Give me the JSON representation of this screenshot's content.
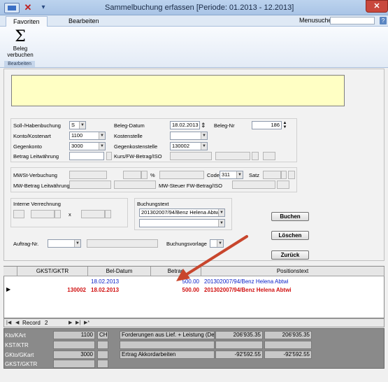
{
  "window": {
    "title": "Sammelbuchung erfassen  [Periode: 01.2013 - 12.2013]",
    "close_glyph": "✕"
  },
  "tabs": [
    {
      "label": "Favoriten"
    },
    {
      "label": "Bearbeiten"
    }
  ],
  "menusuche": {
    "label": "Menusuche",
    "value": "",
    "help": "?"
  },
  "ribbon": {
    "button_icon": "Σ",
    "button_line1": "Beleg",
    "button_line2": "verbuchen",
    "group_label": "Bearbeiten"
  },
  "form": {
    "soll_haben": {
      "label": "Soll-/Habenbuchung",
      "value": "S"
    },
    "konto": {
      "label": "Konto/Kostenart",
      "value": "1100"
    },
    "gegenkonto": {
      "label": "Gegenkonto",
      "value": "3000"
    },
    "betrag_lw": {
      "label": "Betrag Leitwährung",
      "value": ""
    },
    "beleg_datum": {
      "label": "Beleg-Datum",
      "value": "18.02.2013"
    },
    "kostenstelle": {
      "label": "Kostenstelle",
      "value": ""
    },
    "gegenkostenstelle": {
      "label": "Gegenkostenstelle",
      "value": "130002"
    },
    "kurs": {
      "label": "Kurs/FW-Betrag/ISO"
    },
    "beleg_nr": {
      "label": "Beleg-Nr",
      "value": "186"
    },
    "mwst": {
      "label": "MWSt-Verbuchung",
      "percent": "%",
      "code_label": "Code",
      "code_value": "311",
      "satz_label": "Satz"
    },
    "mw_betrag": {
      "label": "MW-Betrag Leitwährung",
      "steuer_label": "MW-Steuer FW-Betrag/ISO"
    },
    "interne": {
      "label": "Interne Verrechnung",
      "x": "x"
    },
    "buchungstext": {
      "label": "Buchungstext",
      "value": "201302007/94/Benz Helena Abtwi"
    },
    "auftrag": {
      "label": "Auftrag-Nr."
    },
    "buchungsvorlage": {
      "label": "Buchungsvorlage"
    }
  },
  "buttons": {
    "buchen": "Buchen",
    "loeschen": "Löschen",
    "zurueck": "Zurück"
  },
  "grid": {
    "headers": [
      "GKST/GKTR",
      "Bel-Datum",
      "Betrag",
      "Positionstext"
    ],
    "rows": [
      {
        "gkst": "",
        "datum": "18.02.2013",
        "betrag": "500.00",
        "text": "201302007/94/Benz Helena Abtwi",
        "style": "blue"
      },
      {
        "gkst": "130002",
        "datum": "18.02.2013",
        "betrag": "500.00",
        "text": "201302007/94/Benz Helena Abtwi",
        "style": "red"
      }
    ],
    "row_indicator": "▶"
  },
  "navigator": {
    "record_label": "Record",
    "record_value": "2"
  },
  "summary": {
    "rows": [
      {
        "label": "Kto/KArt",
        "nr": "1100",
        "cur": "CHF",
        "desc": "Forderungen aus Lief. + Leistung (De",
        "v1": "206'935.35",
        "v2": "206'935.35"
      },
      {
        "label": "KST/KTR",
        "nr": "",
        "cur": "",
        "desc": "",
        "v1": "",
        "v2": ""
      },
      {
        "label": "GKto/GKart",
        "nr": "3000",
        "cur": "",
        "desc": "Ertrag Akkordarbeiten",
        "v1": "-92'592.55",
        "v2": "-92'592.55"
      },
      {
        "label": "GKST/GKTR",
        "nr": "",
        "cur": "",
        "desc": "",
        "v1": "",
        "v2": ""
      }
    ]
  },
  "colors": {
    "annotation_arrow": "#c8462d",
    "row_blue": "#0a1fc8",
    "row_red": "#d01010",
    "note_yellow": "#ffffc4"
  }
}
